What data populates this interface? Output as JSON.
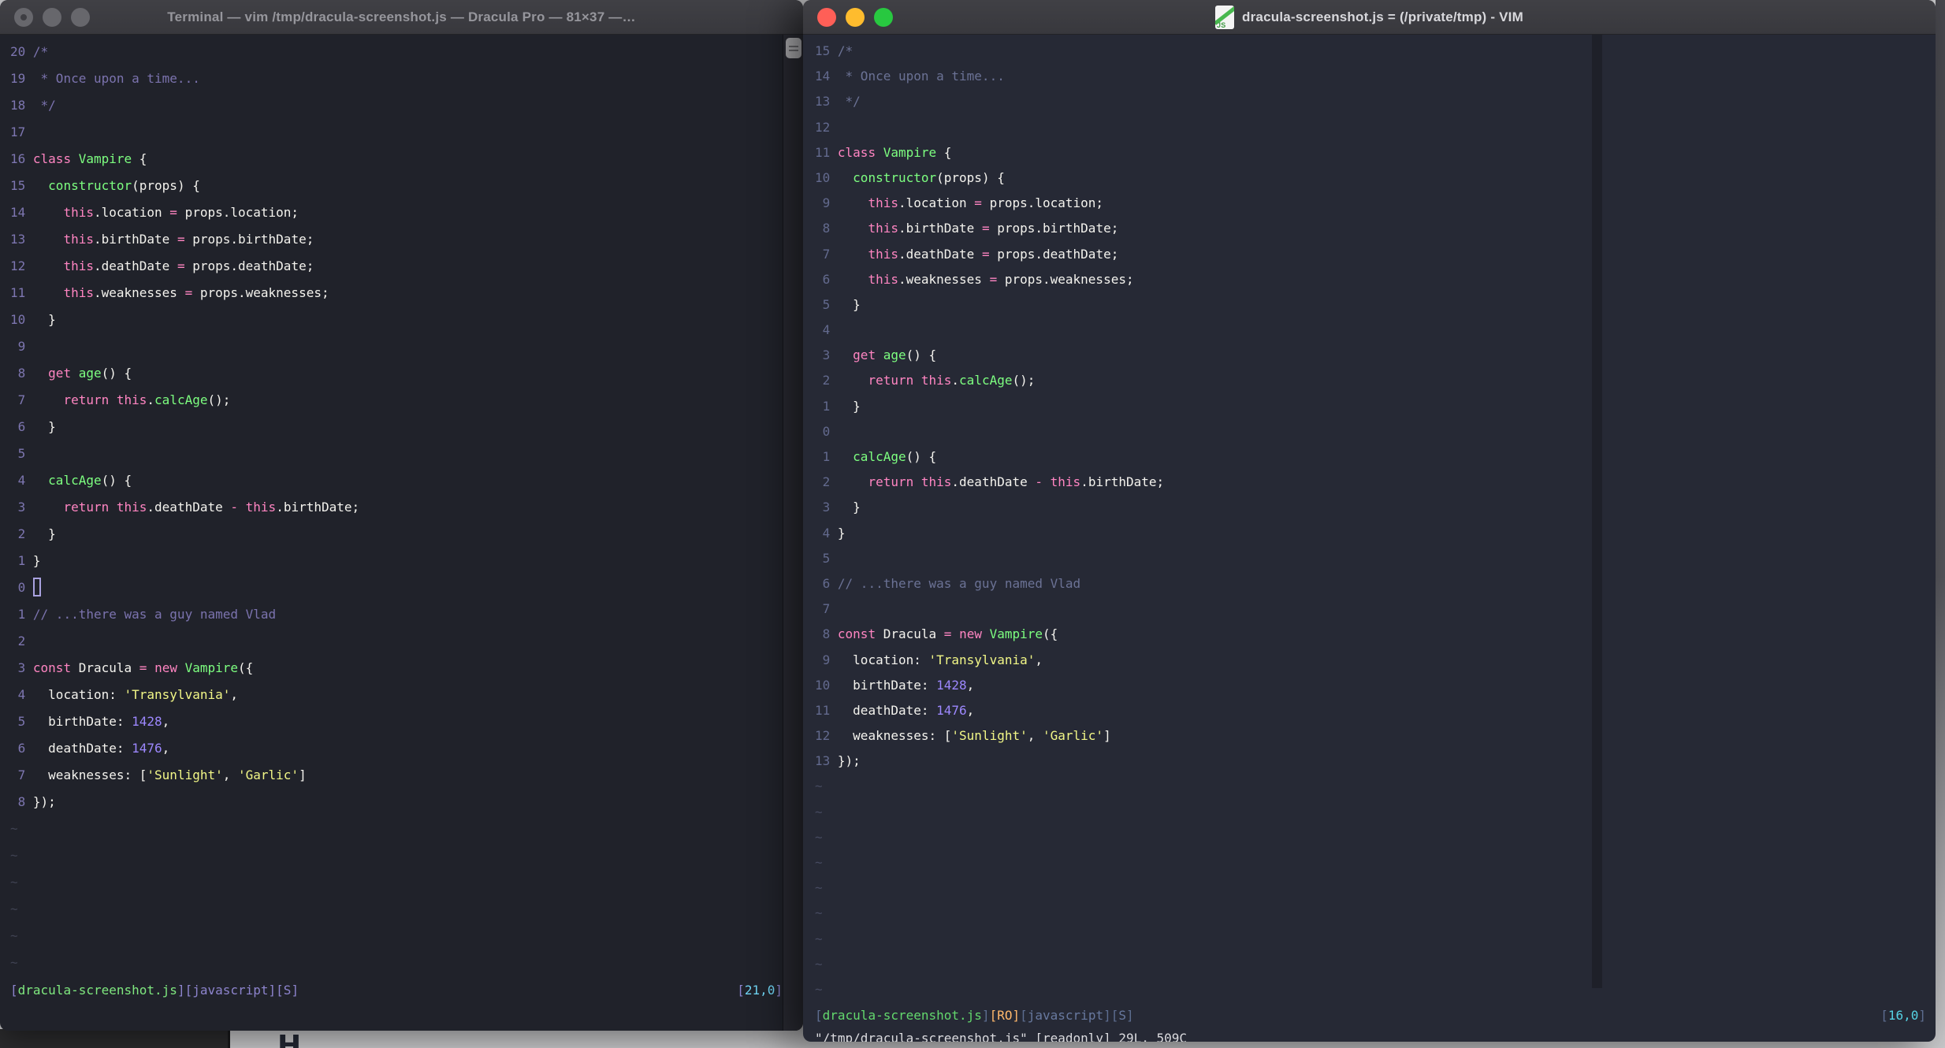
{
  "palette": {
    "keyword_pink": "#ff85c2",
    "function_green": "#7dff80",
    "string_yellow": "#f2f787",
    "number_purple": "#9d88ff",
    "foreground": "#f4f3ee",
    "comment_left": "#7b73ae",
    "comment_right": "#6b7295",
    "linenr_left": "#7d76b0",
    "linenr_right": "#636a8e",
    "bg_left": "#20222a",
    "bg_right": "#262935",
    "traffic_red": "#ff5f57",
    "traffic_yellow": "#febc2e",
    "traffic_green": "#28c840",
    "traffic_inactive": "#67676c",
    "status_cyan": "#6fd4f2",
    "status_orange": "#ffb86c",
    "status_green": "#63d86d"
  },
  "code": {
    "lines": [
      {
        "tokens": [
          [
            "c",
            "/*"
          ]
        ]
      },
      {
        "tokens": [
          [
            "c",
            " * Once upon a time..."
          ]
        ]
      },
      {
        "tokens": [
          [
            "c",
            " */"
          ]
        ]
      },
      {
        "tokens": []
      },
      {
        "tokens": [
          [
            "k",
            "class"
          ],
          [
            "p",
            " "
          ],
          [
            "f",
            "Vampire"
          ],
          [
            "p",
            " {"
          ]
        ]
      },
      {
        "tokens": [
          [
            "p",
            "  "
          ],
          [
            "f",
            "constructor"
          ],
          [
            "p",
            "(props) {"
          ]
        ]
      },
      {
        "tokens": [
          [
            "p",
            "    "
          ],
          [
            "k",
            "this"
          ],
          [
            "p",
            ".location "
          ],
          [
            "k",
            "="
          ],
          [
            "p",
            " props.location;"
          ]
        ]
      },
      {
        "tokens": [
          [
            "p",
            "    "
          ],
          [
            "k",
            "this"
          ],
          [
            "p",
            ".birthDate "
          ],
          [
            "k",
            "="
          ],
          [
            "p",
            " props.birthDate;"
          ]
        ]
      },
      {
        "tokens": [
          [
            "p",
            "    "
          ],
          [
            "k",
            "this"
          ],
          [
            "p",
            ".deathDate "
          ],
          [
            "k",
            "="
          ],
          [
            "p",
            " props.deathDate;"
          ]
        ]
      },
      {
        "tokens": [
          [
            "p",
            "    "
          ],
          [
            "k",
            "this"
          ],
          [
            "p",
            ".weaknesses "
          ],
          [
            "k",
            "="
          ],
          [
            "p",
            " props.weaknesses;"
          ]
        ]
      },
      {
        "tokens": [
          [
            "p",
            "  }"
          ]
        ]
      },
      {
        "tokens": []
      },
      {
        "tokens": [
          [
            "p",
            "  "
          ],
          [
            "k",
            "get"
          ],
          [
            "p",
            " "
          ],
          [
            "f",
            "age"
          ],
          [
            "p",
            "() {"
          ]
        ]
      },
      {
        "tokens": [
          [
            "p",
            "    "
          ],
          [
            "k",
            "return"
          ],
          [
            "p",
            " "
          ],
          [
            "k",
            "this"
          ],
          [
            "p",
            "."
          ],
          [
            "f",
            "calcAge"
          ],
          [
            "p",
            "();"
          ]
        ]
      },
      {
        "tokens": [
          [
            "p",
            "  }"
          ]
        ]
      },
      {
        "tokens": []
      },
      {
        "tokens": [
          [
            "p",
            "  "
          ],
          [
            "f",
            "calcAge"
          ],
          [
            "p",
            "() {"
          ]
        ]
      },
      {
        "tokens": [
          [
            "p",
            "    "
          ],
          [
            "k",
            "return"
          ],
          [
            "p",
            " "
          ],
          [
            "k",
            "this"
          ],
          [
            "p",
            ".deathDate "
          ],
          [
            "k",
            "-"
          ],
          [
            "p",
            " "
          ],
          [
            "k",
            "this"
          ],
          [
            "p",
            ".birthDate;"
          ]
        ]
      },
      {
        "tokens": [
          [
            "p",
            "  }"
          ]
        ]
      },
      {
        "tokens": [
          [
            "p",
            "}"
          ]
        ]
      },
      {
        "tokens": []
      },
      {
        "tokens": [
          [
            "c",
            "// ...there was a guy named Vlad"
          ]
        ]
      },
      {
        "tokens": []
      },
      {
        "tokens": [
          [
            "k",
            "const"
          ],
          [
            "p",
            " Dracula "
          ],
          [
            "k",
            "="
          ],
          [
            "p",
            " "
          ],
          [
            "k",
            "new"
          ],
          [
            "p",
            " "
          ],
          [
            "f",
            "Vampire"
          ],
          [
            "p",
            "({"
          ]
        ]
      },
      {
        "tokens": [
          [
            "p",
            "  location: "
          ],
          [
            "s",
            "'Transylvania'"
          ],
          [
            "p",
            ","
          ]
        ]
      },
      {
        "tokens": [
          [
            "p",
            "  birthDate: "
          ],
          [
            "n",
            "1428"
          ],
          [
            "p",
            ","
          ]
        ]
      },
      {
        "tokens": [
          [
            "p",
            "  deathDate: "
          ],
          [
            "n",
            "1476"
          ],
          [
            "p",
            ","
          ]
        ]
      },
      {
        "tokens": [
          [
            "p",
            "  weaknesses: ["
          ],
          [
            "s",
            "'Sunlight'"
          ],
          [
            "p",
            ", "
          ],
          [
            "s",
            "'Garlic'"
          ],
          [
            "p",
            "]"
          ]
        ]
      },
      {
        "tokens": [
          [
            "p",
            "});"
          ]
        ]
      }
    ]
  },
  "left_window": {
    "title": "Terminal — vim /tmp/dracula-screenshot.js — Dracula Pro — 81×37 —…",
    "cursor_file_line": 21,
    "cursor_visible": true,
    "tilde_count": 6,
    "status_left": [
      [
        "br",
        "["
      ],
      [
        "file",
        "dracula-screenshot.js"
      ],
      [
        "br",
        "]["
      ],
      [
        "lbl",
        "javascript"
      ],
      [
        "br",
        "]["
      ],
      [
        "lbl",
        "S"
      ],
      [
        "br",
        "]"
      ]
    ],
    "status_right": [
      [
        "br",
        "["
      ],
      [
        "pos",
        "21,0"
      ],
      [
        "br",
        "]"
      ]
    ],
    "command_line": ""
  },
  "right_window": {
    "title": "dracula-screenshot.js = (/private/tmp) - VIM",
    "doc_icon_label": "JS",
    "cursor_file_line": 16,
    "cursor_visible": false,
    "tilde_count": 9,
    "status_left": [
      [
        "br",
        "["
      ],
      [
        "file",
        "dracula-screenshot.js"
      ],
      [
        "br",
        "]"
      ],
      [
        "ro",
        "[RO]"
      ],
      [
        "br",
        "["
      ],
      [
        "lbl",
        "javascript"
      ],
      [
        "br",
        "]["
      ],
      [
        "lbl",
        "S"
      ],
      [
        "br",
        "]"
      ]
    ],
    "status_right": [
      [
        "br",
        "["
      ],
      [
        "pos",
        "16,0"
      ],
      [
        "br",
        "]"
      ]
    ],
    "message_line": "\"/tmp/dracula-screenshot.js\" [readonly] 29L, 509C"
  },
  "desktop": {
    "partial_glyph": "H"
  }
}
